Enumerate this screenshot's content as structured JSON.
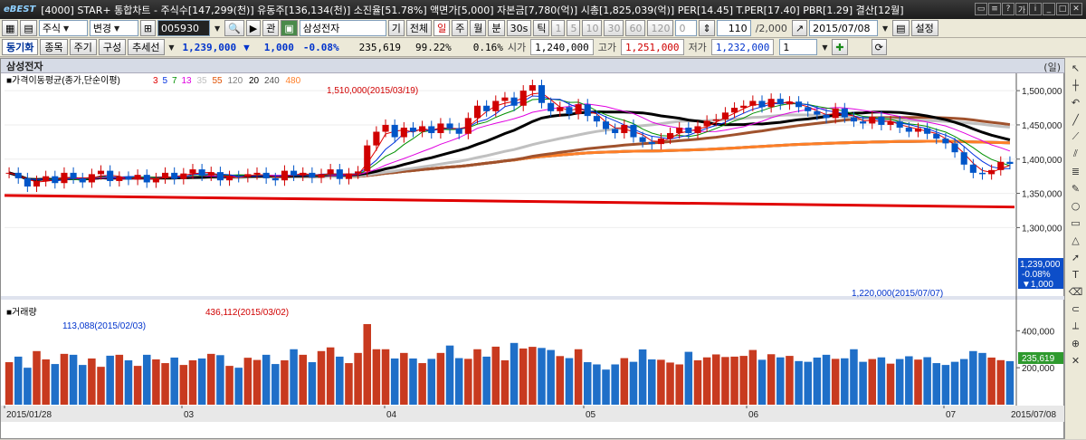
{
  "titlebar": {
    "logo": "eBEST",
    "title": "[4000] STAR+ 통합차트 - 주식수[147,299(천)] 유동주[136,134(천)] 소진율[51.78%] 액면가[5,000] 자본금[7,780(억)] 시총[1,825,039(억)] PER[14.45] T.PER[17.40] PBR[1.29] 결산[12월]"
  },
  "toolbar1": {
    "market": "주식",
    "mode": "변경",
    "code": "005930",
    "gwan": "관",
    "stock_name": "삼성전자",
    "gi": "기",
    "all": "전체",
    "day": "일",
    "week": "주",
    "month": "월",
    "minute": "분",
    "sec30": "30s",
    "tick": "틱",
    "periods": [
      "1",
      "5",
      "10",
      "30",
      "60",
      "120"
    ],
    "zero": "0",
    "count": "110",
    "total": "/2,000",
    "date": "2015/07/08",
    "settings": "설정"
  },
  "toolbar2": {
    "sync": "동기화",
    "item": "종목",
    "period": "주기",
    "compose": "구성",
    "trendline": "추세선",
    "price": "1,239,000",
    "arrow": "▼",
    "change": "1,000",
    "change_pct": "-0.08%",
    "volume": "235,619",
    "ratio": "99.22%",
    "turnover": "0.16%",
    "open_label": "시가",
    "open": "1,240,000",
    "high_label": "고가",
    "high": "1,251,000",
    "low_label": "저가",
    "low": "1,232,000",
    "one": "1"
  },
  "chart": {
    "stock_title": "삼성전자",
    "unit": "(일)",
    "ma_label": "가격이동평균(종가,단순이평)",
    "ma_periods": [
      "3",
      "5",
      "7",
      "13",
      "35",
      "55",
      "120",
      "20",
      "240",
      "480"
    ],
    "ma_colors": [
      "#e00000",
      "#0030e0",
      "#009000",
      "#e000e0",
      "#c0c0c0",
      "#e05000",
      "#808080",
      "#000000",
      "#505050",
      "#ff7f27"
    ],
    "y_ticks": [
      "1,500,000",
      "1,450,000",
      "1,400,000",
      "1,350,000",
      "1,300,000"
    ],
    "high_annotation": "1,510,000(2015/03/19)",
    "low_annotation": "1,220,000(2015/07/07)",
    "last_price": "1,239,000",
    "last_change_pct": "-0.08%",
    "last_change": "▼1,000",
    "volume_label": "거래량",
    "vol_y_ticks": [
      "400,000",
      "200,000"
    ],
    "vol_high_annotation": "436,112(2015/03/02)",
    "vol_low_annotation": "113,088(2015/02/03)",
    "last_volume": "235,619",
    "x_ticks": [
      "2015/01/28",
      "03",
      "04",
      "05",
      "06",
      "07",
      "2015/07/08"
    ]
  },
  "chart_data": {
    "type": "candlestick",
    "ylim": [
      1200000,
      1520000
    ],
    "closes": [
      1380000,
      1372000,
      1360000,
      1368000,
      1375000,
      1365000,
      1380000,
      1372000,
      1366000,
      1378000,
      1383000,
      1368000,
      1374000,
      1370000,
      1377000,
      1366000,
      1372000,
      1380000,
      1371000,
      1379000,
      1385000,
      1376000,
      1381000,
      1369000,
      1375000,
      1374000,
      1378000,
      1380000,
      1372000,
      1369000,
      1383000,
      1376000,
      1380000,
      1373000,
      1378000,
      1385000,
      1371000,
      1379000,
      1382000,
      1420000,
      1440000,
      1450000,
      1432000,
      1446000,
      1440000,
      1448000,
      1438000,
      1452000,
      1445000,
      1437000,
      1460000,
      1478000,
      1470000,
      1485000,
      1490000,
      1478000,
      1500000,
      1508000,
      1482000,
      1470000,
      1476000,
      1466000,
      1480000,
      1463000,
      1455000,
      1444000,
      1438000,
      1450000,
      1432000,
      1425000,
      1422000,
      1430000,
      1438000,
      1446000,
      1438000,
      1448000,
      1456000,
      1458000,
      1468000,
      1475000,
      1478000,
      1485000,
      1476000,
      1488000,
      1480000,
      1484000,
      1476000,
      1470000,
      1465000,
      1460000,
      1474000,
      1461000,
      1455000,
      1452000,
      1462000,
      1450000,
      1455000,
      1446000,
      1440000,
      1445000,
      1437000,
      1430000,
      1423000,
      1410000,
      1392000,
      1380000,
      1378000,
      1384000,
      1396000,
      1393000
    ],
    "volumes": [
      230000,
      260000,
      200000,
      290000,
      245000,
      220000,
      275000,
      270000,
      215000,
      250000,
      205000,
      265000,
      270000,
      240000,
      210000,
      270000,
      245000,
      225000,
      255000,
      215000,
      240000,
      250000,
      275000,
      268000,
      210000,
      200000,
      254000,
      242000,
      270000,
      220000,
      240000,
      300000,
      270000,
      230000,
      290000,
      310000,
      260000,
      225000,
      280000,
      436112,
      300000,
      300000,
      250000,
      280000,
      250000,
      225000,
      248000,
      280000,
      320000,
      252000,
      248000,
      300000,
      260000,
      314000,
      240000,
      334000,
      304000,
      313000,
      307000,
      296000,
      263000,
      252000,
      300000,
      230000,
      218000,
      190000,
      218000,
      252000,
      232000,
      299000,
      245000,
      243000,
      228000,
      218000,
      286000,
      240000,
      256000,
      272000,
      258000,
      260000,
      264000,
      296000,
      243000,
      273000,
      256000,
      264000,
      236000,
      232000,
      255000,
      270000,
      248000,
      251000,
      300000,
      232000,
      247000,
      256000,
      222000,
      247000,
      262000,
      244000,
      257000,
      225000,
      215000,
      232000,
      247000,
      290000,
      280000,
      255000,
      241000,
      235619
    ]
  }
}
